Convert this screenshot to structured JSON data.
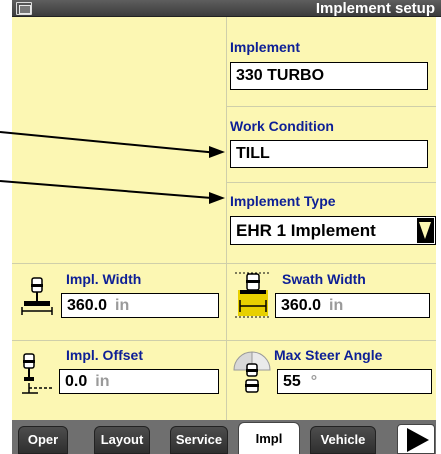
{
  "window": {
    "title": "Implement setup"
  },
  "fields": {
    "implement": {
      "label": "Implement",
      "value": "330 TURBO"
    },
    "work_condition": {
      "label": "Work Condition",
      "value": "TILL"
    },
    "implement_type": {
      "label": "Implement Type",
      "value": "EHR 1 Implement"
    },
    "impl_width": {
      "label": "Impl. Width",
      "value": "360.0",
      "unit": "in"
    },
    "swath_width": {
      "label": "Swath Width",
      "value": "360.0",
      "unit": "in"
    },
    "impl_offset": {
      "label": "Impl. Offset",
      "value": "0.0",
      "unit": "in"
    },
    "max_steer_angle": {
      "label": "Max Steer Angle",
      "value": "55",
      "unit": "°"
    }
  },
  "tabs": [
    {
      "label": "Oper"
    },
    {
      "label": "Layout"
    },
    {
      "label": "Service"
    },
    {
      "label": "Impl",
      "active": true
    },
    {
      "label": "Vehicle"
    }
  ],
  "colors": {
    "panel_background": "#fcf7b3",
    "label_text": "#0d1f96",
    "title_bar": "#4a4a4a",
    "unit_text": "#9a9a9a"
  },
  "icons": {
    "title": "screen-icon",
    "impl_width": "implement-width-icon",
    "swath_width": "swath-width-icon",
    "impl_offset": "implement-offset-icon",
    "max_steer_angle": "steer-angle-icon",
    "dropdown": "dropdown-arrow-icon",
    "next_tabs": "next-arrow-icon"
  }
}
